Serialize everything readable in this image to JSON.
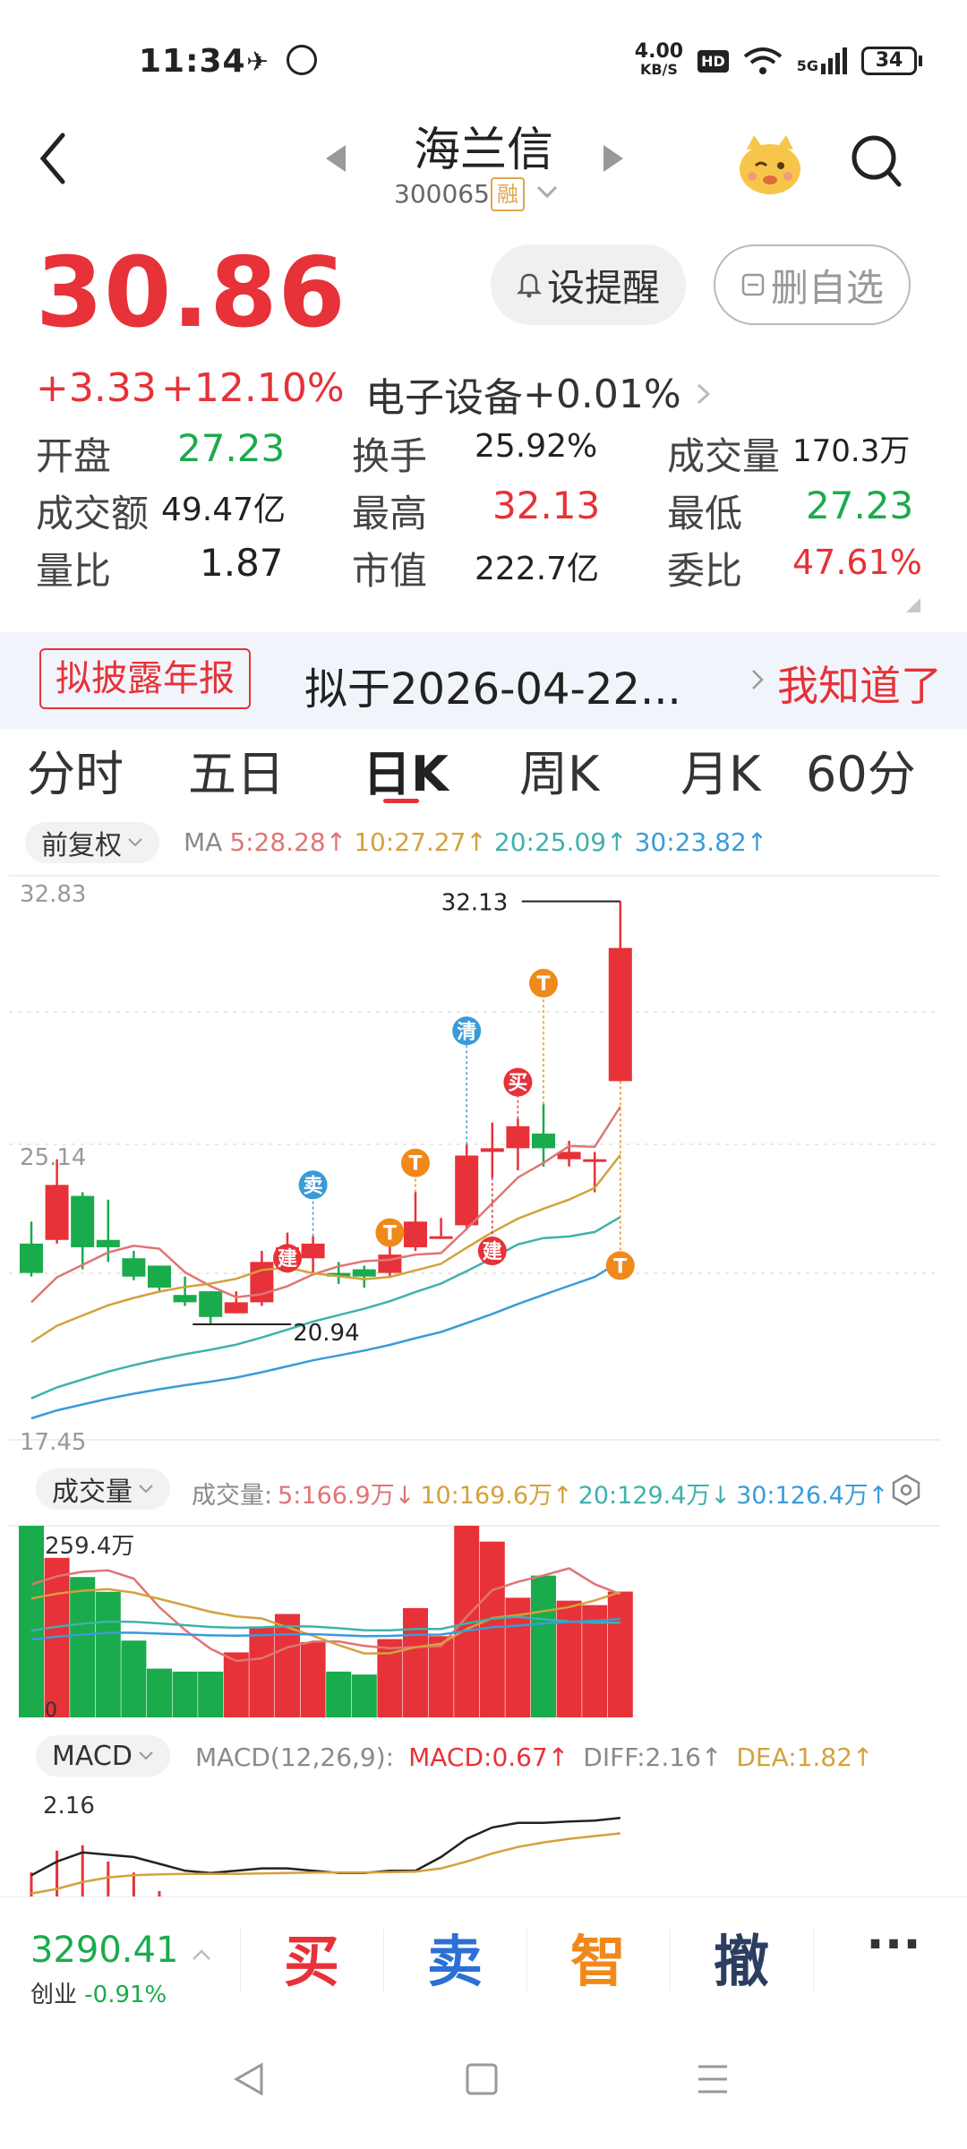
{
  "status": {
    "time": "11:34",
    "net_speed": "4.00",
    "net_unit": "KB/S",
    "hd": "HD",
    "signal": "5G",
    "battery": "34"
  },
  "header": {
    "title": "海兰信",
    "code": "300065",
    "badge": "融"
  },
  "quote": {
    "price": "30.86",
    "change": "+3.33",
    "change_pct": "+12.10%",
    "sector": "电子设备",
    "sector_pct": "+0.01%",
    "alert_label": "设提醒",
    "remove_label": "删自选"
  },
  "stats": {
    "open_label": "开盘",
    "open": "27.23",
    "turnover_label": "换手",
    "turnover": "25.92%",
    "volume_label": "成交量",
    "volume": "170.3万",
    "amount_label": "成交额",
    "amount": "49.47亿",
    "high_label": "最高",
    "high": "32.13",
    "low_label": "最低",
    "low": "27.23",
    "vol_ratio_label": "量比",
    "vol_ratio": "1.87",
    "mcap_label": "市值",
    "mcap": "222.7亿",
    "bid_ratio_label": "委比",
    "bid_ratio": "47.61%"
  },
  "notice": {
    "tag": "拟披露年报",
    "text": "拟于2026-04-22...",
    "action": "我知道了"
  },
  "tabs": [
    "分时",
    "五日",
    "日K",
    "周K",
    "月K",
    "60分"
  ],
  "active_tab": 2,
  "kline": {
    "adjust": "前复权",
    "ma_prefix": "MA",
    "ma5": "5:28.28↑",
    "ma10": "10:27.27↑",
    "ma20": "20:25.09↑",
    "ma30": "30:23.82↑",
    "y_top": "32.83",
    "y_mid": "25.14",
    "y_bot": "17.45",
    "high_mark": "32.13",
    "low_mark": "20.94",
    "signals": [
      "建",
      "卖",
      "T",
      "T",
      "清",
      "建",
      "买",
      "T",
      "T"
    ]
  },
  "volume": {
    "label": "成交量",
    "prefix": "成交量:",
    "v5": "5:166.9万↓",
    "v10": "10:169.6万↑",
    "v20": "20:129.4万↓",
    "v30": "30:126.4万↑",
    "top": "259.4万",
    "zero": "0"
  },
  "macd": {
    "label": "MACD",
    "params": "MACD(12,26,9):",
    "macd": "MACD:0.67↑",
    "diff": "DIFF:2.16↑",
    "dea": "DEA:1.82↑",
    "top": "2.16"
  },
  "bottom": {
    "index_value": "3290.41",
    "index_name": "创业",
    "index_pct": "-0.91%",
    "buy": "买",
    "sell": "卖",
    "smart": "智",
    "cancel": "撤",
    "more": "···"
  },
  "colors": {
    "up": "#e63238",
    "down": "#1aab4c",
    "ma5": "#e07575",
    "ma10": "#d4a13c",
    "ma20": "#3fb1ad",
    "ma30": "#3a9bd8",
    "signal_red": "#e63238",
    "signal_blue": "#3a9bd8",
    "signal_orange": "#f0891a"
  },
  "chart_data": {
    "type": "candlestick",
    "y_range": [
      17.45,
      32.83
    ],
    "candles": [
      {
        "o": 22.8,
        "h": 23.4,
        "l": 21.9,
        "c": 22.0
      },
      {
        "o": 22.9,
        "h": 25.1,
        "l": 22.8,
        "c": 24.4
      },
      {
        "o": 24.1,
        "h": 24.2,
        "l": 22.1,
        "c": 22.7
      },
      {
        "o": 22.9,
        "h": 24.0,
        "l": 22.3,
        "c": 22.7
      },
      {
        "o": 22.4,
        "h": 22.6,
        "l": 21.8,
        "c": 21.9
      },
      {
        "o": 22.2,
        "h": 22.2,
        "l": 21.5,
        "c": 21.6
      },
      {
        "o": 21.4,
        "h": 21.9,
        "l": 21.1,
        "c": 21.2
      },
      {
        "o": 21.5,
        "h": 21.5,
        "l": 20.6,
        "c": 20.8
      },
      {
        "o": 20.9,
        "h": 21.5,
        "l": 20.9,
        "c": 21.2
      },
      {
        "o": 21.2,
        "h": 22.6,
        "l": 21.1,
        "c": 22.3
      },
      {
        "o": 22.3,
        "h": 23.1,
        "l": 22.1,
        "c": 22.7
      },
      {
        "o": 22.4,
        "h": 23.0,
        "l": 22.0,
        "c": 22.8
      },
      {
        "o": 22.0,
        "h": 22.3,
        "l": 21.7,
        "c": 21.9
      },
      {
        "o": 22.1,
        "h": 22.2,
        "l": 21.6,
        "c": 21.9
      },
      {
        "o": 22.0,
        "h": 23.1,
        "l": 21.9,
        "c": 22.5
      },
      {
        "o": 22.7,
        "h": 24.2,
        "l": 22.6,
        "c": 23.4
      },
      {
        "o": 23.0,
        "h": 23.5,
        "l": 23.0,
        "c": 23.0
      },
      {
        "o": 23.3,
        "h": 25.5,
        "l": 23.2,
        "c": 25.2
      },
      {
        "o": 25.3,
        "h": 26.1,
        "l": 24.6,
        "c": 25.4
      },
      {
        "o": 25.4,
        "h": 26.2,
        "l": 24.8,
        "c": 26.0
      },
      {
        "o": 25.8,
        "h": 26.6,
        "l": 24.9,
        "c": 25.4
      },
      {
        "o": 25.1,
        "h": 25.6,
        "l": 24.9,
        "c": 25.3
      },
      {
        "o": 25.1,
        "h": 25.3,
        "l": 24.2,
        "c": 25.1
      },
      {
        "o": 27.23,
        "h": 32.13,
        "l": 27.23,
        "c": 30.86
      }
    ],
    "volumes": [
      259.4,
      216,
      190,
      170,
      104,
      66,
      62,
      62,
      88,
      122,
      140,
      102,
      62,
      58,
      106,
      148,
      110,
      259.4,
      238,
      162,
      192,
      158,
      152,
      170.3
    ],
    "macd_diff": [
      0.9,
      1.2,
      1.4,
      1.35,
      1.3,
      1.15,
      1.0,
      0.95,
      1.0,
      1.05,
      1.05,
      1.0,
      0.95,
      0.95,
      1.0,
      1.0,
      1.3,
      1.7,
      1.95,
      2.05,
      2.05,
      2.08,
      2.1,
      2.16
    ],
    "macd_dea": [
      0.5,
      0.6,
      0.75,
      0.85,
      0.9,
      0.92,
      0.93,
      0.93,
      0.93,
      0.94,
      0.95,
      0.96,
      0.96,
      0.96,
      0.97,
      0.98,
      1.05,
      1.2,
      1.38,
      1.52,
      1.62,
      1.7,
      1.76,
      1.82
    ]
  }
}
